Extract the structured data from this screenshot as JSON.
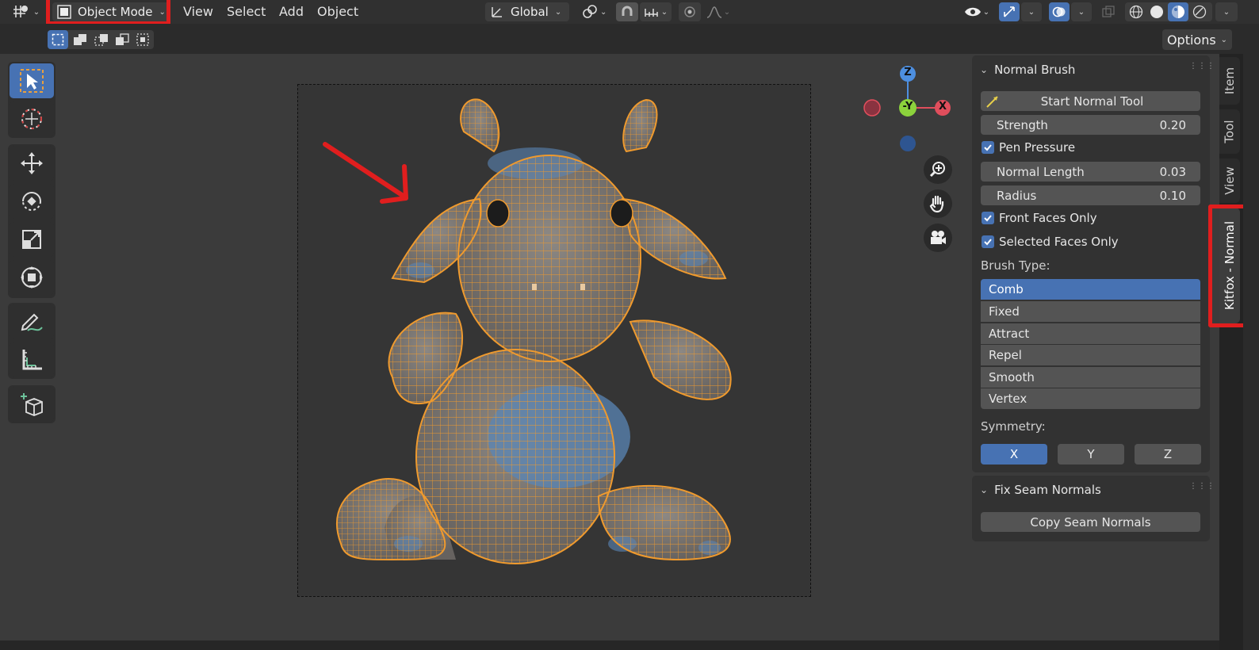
{
  "header": {
    "mode_label": "Object Mode",
    "menus": [
      "View",
      "Select",
      "Add",
      "Object"
    ],
    "transform_orientation": "Global",
    "options_label": "Options"
  },
  "tabs": [
    "Item",
    "Tool",
    "View",
    "Kitfox - Normal"
  ],
  "normal_brush": {
    "title": "Normal Brush",
    "start_button": "Start Normal Tool",
    "strength_label": "Strength",
    "strength_value": "0.20",
    "pen_pressure": "Pen Pressure",
    "normal_length_label": "Normal Length",
    "normal_length_value": "0.03",
    "radius_label": "Radius",
    "radius_value": "0.10",
    "front_faces": "Front Faces Only",
    "selected_faces": "Selected Faces Only",
    "brush_type_label": "Brush Type:",
    "brush_types": [
      "Comb",
      "Fixed",
      "Attract",
      "Repel",
      "Smooth",
      "Vertex"
    ],
    "symmetry_label": "Symmetry:",
    "symmetry": [
      "X",
      "Y",
      "Z"
    ]
  },
  "fix_seam": {
    "title": "Fix Seam Normals",
    "button": "Copy Seam Normals"
  },
  "gizmo": {
    "z": "Z",
    "y": "-Y",
    "x": "X"
  },
  "colors": {
    "accent": "#4772b3",
    "highlight_red": "#e01e1e",
    "wire_orange": "#ef9a2e"
  }
}
